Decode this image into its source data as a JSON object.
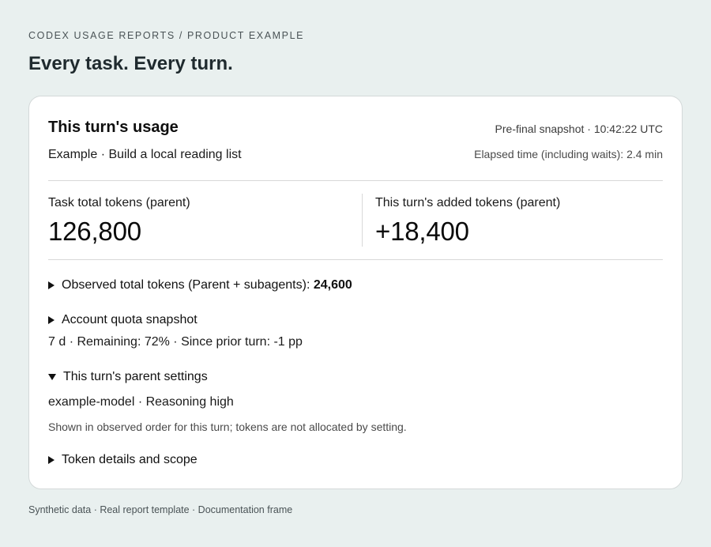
{
  "header": {
    "eyebrow": "CODEX USAGE REPORTS / PRODUCT EXAMPLE",
    "title": "Every task. Every turn."
  },
  "card": {
    "title": "This turn's usage",
    "snapshot": "Pre-final snapshot · 10:42:22 UTC",
    "subtitle": "Example · Build a local reading list",
    "elapsed": "Elapsed time (including waits): 2.4 min",
    "stats": {
      "task_total_label": "Task total tokens (parent)",
      "task_total_value": "126,800",
      "turn_added_label": "This turn's added tokens (parent)",
      "turn_added_value": "+18,400"
    },
    "sections": {
      "observed_label": "Observed total tokens (Parent + subagents):",
      "observed_value": "24,600",
      "quota_label": "Account quota snapshot",
      "quota_detail": "7 d · Remaining: 72% · Since prior turn: -1 pp",
      "settings_label": "This turn's parent settings",
      "settings_detail": "example-model · Reasoning high",
      "settings_note": "Shown in observed order for this turn; tokens are not allocated by setting.",
      "token_details_label": "Token details and scope"
    }
  },
  "footer": {
    "text": "Synthetic data · Real report template · Documentation frame"
  }
}
